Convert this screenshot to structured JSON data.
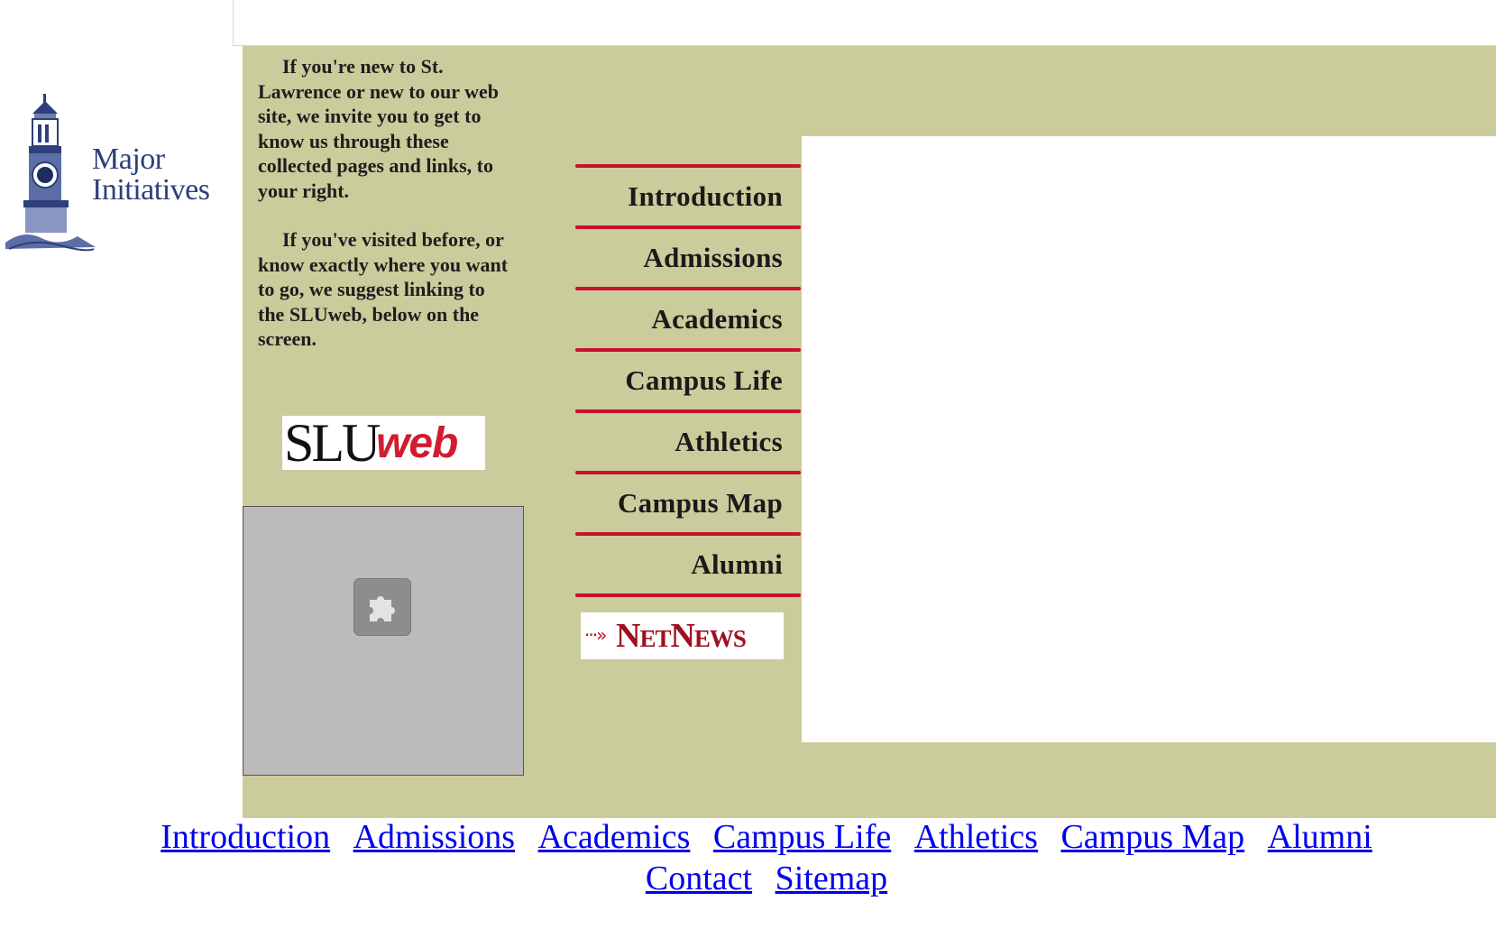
{
  "logo": {
    "line1": "Major",
    "line2": "Initiatives",
    "icon": "clock-tower-icon"
  },
  "intro": {
    "para1": "If you're new to St. Lawrence or new to our web site, we invite you to get to know us through these collected pages and links, to your right.",
    "para2": "If you've visited before, or know exactly where you want to go, we suggest linking to the SLUweb, below on the screen."
  },
  "sluweb": {
    "part1": "SLU",
    "part2": "web"
  },
  "plugin": {
    "icon": "plugin-puzzle-icon"
  },
  "nav": {
    "items": [
      {
        "label": "Introduction"
      },
      {
        "label": "Admissions"
      },
      {
        "label": "Academics"
      },
      {
        "label": "Campus Life"
      },
      {
        "label": "Athletics"
      },
      {
        "label": "Campus Map"
      },
      {
        "label": "Alumni"
      }
    ]
  },
  "netnews": {
    "arrow": "···»",
    "label": "NetNews"
  },
  "footer": {
    "links": [
      "Introduction",
      "Admissions",
      "Academics",
      "Campus Life",
      "Athletics",
      "Campus Map",
      "Alumni",
      "Contact",
      "Sitemap"
    ]
  },
  "colors": {
    "tan": "#cbcc9b",
    "rule_red": "#c8102e",
    "link_blue": "#0000ee",
    "logo_blue": "#2e3f7c"
  }
}
